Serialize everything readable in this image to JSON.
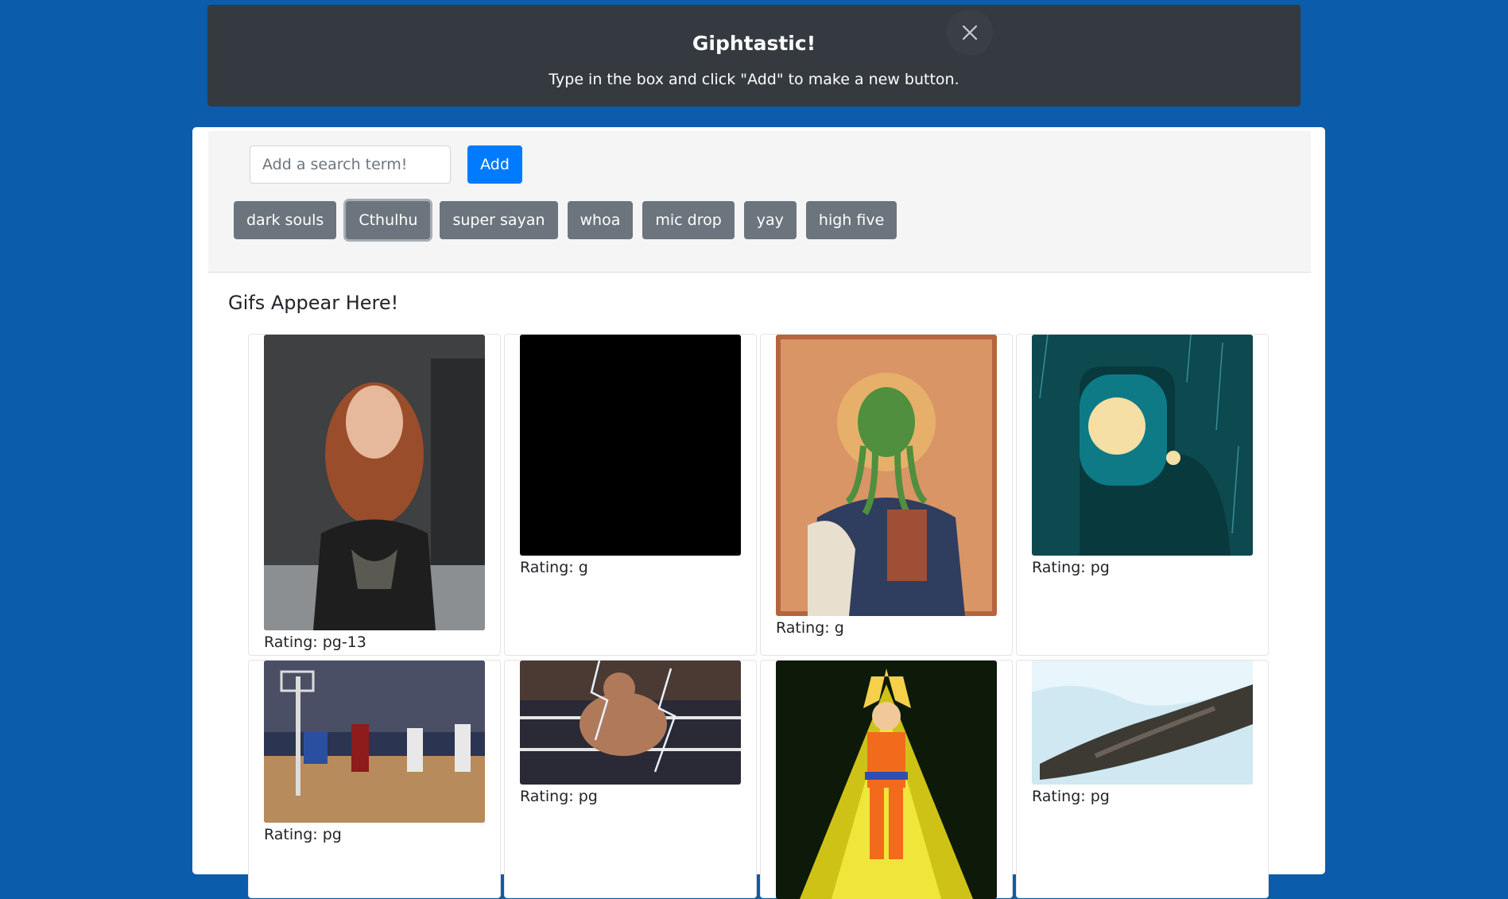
{
  "header": {
    "title": "Giphtastic!",
    "instructions": "Type in the box and click \"Add\" to make a new button."
  },
  "search": {
    "placeholder": "Add a search term!",
    "value": "",
    "add_label": "Add"
  },
  "topics": [
    {
      "label": "dark souls"
    },
    {
      "label": "Cthulhu",
      "focused": true
    },
    {
      "label": "super sayan"
    },
    {
      "label": "whoa"
    },
    {
      "label": "mic drop"
    },
    {
      "label": "yay"
    },
    {
      "label": "high five"
    }
  ],
  "results": {
    "heading": "Gifs Appear Here!",
    "gifs": [
      {
        "rating": "Rating: pg-13"
      },
      {
        "rating": "Rating: g"
      },
      {
        "rating": "Rating: g"
      },
      {
        "rating": "Rating: pg"
      },
      {
        "rating": "Rating: pg"
      },
      {
        "rating": "Rating: pg"
      },
      {
        "rating": ""
      },
      {
        "rating": "Rating: pg"
      }
    ]
  },
  "colors": {
    "page_background": "#0b5cab",
    "header_background": "#343a40",
    "primary_button": "#007bff",
    "topic_button": "#6c757d"
  }
}
